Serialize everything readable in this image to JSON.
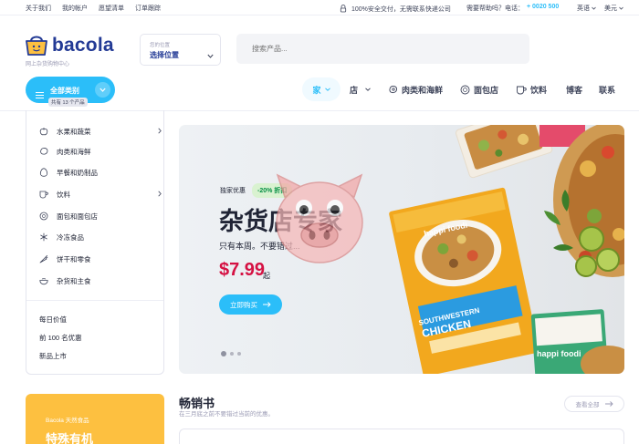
{
  "topbar": {
    "links": [
      "关于我们",
      "我的帐户",
      "愿望清单",
      "订单跟踪"
    ],
    "secure_text": "100%安全交付，无需联系快递公司",
    "help_text": "需要帮助吗？电话：",
    "phone": "+ 0020 500",
    "language": "英语",
    "currency": "美元"
  },
  "logo": {
    "name": "bacola",
    "tagline": "网上杂货购物中心"
  },
  "location": {
    "small_label": "您的位置",
    "value": "选择位置"
  },
  "search": {
    "placeholder": "搜索产品..."
  },
  "nav": {
    "all_categories": "全部类别",
    "product_count": "共有 13 个产品",
    "home": "家",
    "shop": "店",
    "meats": "肉类和海鲜",
    "bakery": "面包店",
    "drinks": "饮料",
    "blog": "博客",
    "contact": "联系"
  },
  "sidebar": {
    "categories": [
      {
        "label": "水果和蔬菜",
        "icon": "apple-icon",
        "has_sub": true
      },
      {
        "label": "肉类和海鲜",
        "icon": "meat-icon",
        "has_sub": false
      },
      {
        "label": "早餐和奶制品",
        "icon": "egg-icon",
        "has_sub": false
      },
      {
        "label": "饮料",
        "icon": "cup-icon",
        "has_sub": true
      },
      {
        "label": "面包和面包店",
        "icon": "bread-icon",
        "has_sub": false
      },
      {
        "label": "冷冻食品",
        "icon": "snowflake-icon",
        "has_sub": false
      },
      {
        "label": "饼干和零食",
        "icon": "carrot-icon",
        "has_sub": false
      },
      {
        "label": "杂货和主食",
        "icon": "bowl-icon",
        "has_sub": false
      }
    ],
    "extras": [
      "每日价值",
      "前 100 名优惠",
      "新品上市"
    ]
  },
  "hero": {
    "exclusive": "独家优惠",
    "discount": "-20% 折扣",
    "title": "杂货店专家",
    "subtitle": "只有本周。不要错过...",
    "price": "$7.99",
    "from": "起",
    "button": "立即购买",
    "slides": 3,
    "active_slide": 1
  },
  "promo": {
    "small": "Bacola 天然食品",
    "big": "特殊有机"
  },
  "bestsellers": {
    "title": "畅销书",
    "subtitle": "在三月底之前不要错过当前的优惠。",
    "view_all": "查看全部"
  },
  "colors": {
    "accent": "#2bbef9",
    "brand": "#233a95",
    "price": "#d51243",
    "promo": "#fdc040",
    "discount_text": "#038e42"
  }
}
